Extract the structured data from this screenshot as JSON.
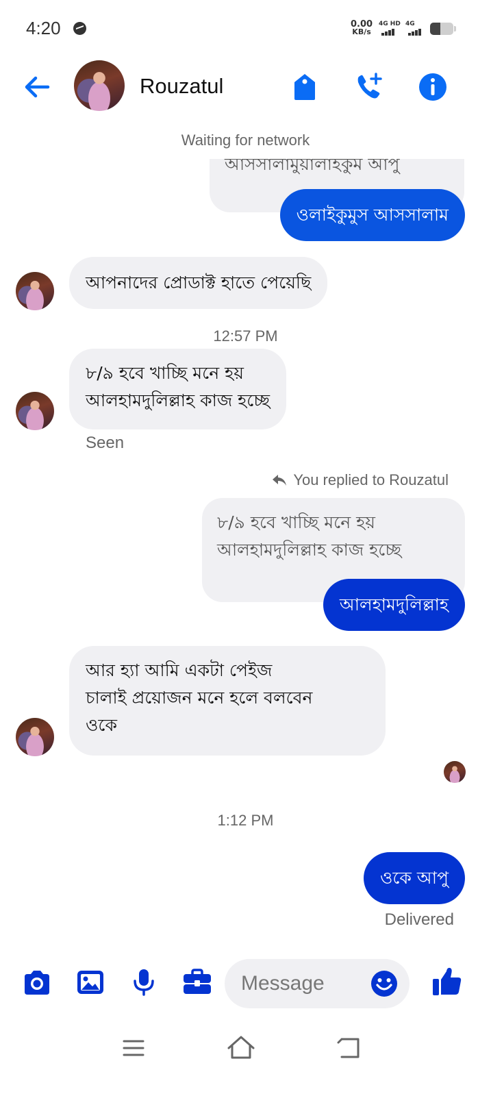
{
  "status_bar": {
    "time": "4:20",
    "net_speed_value": "0.00",
    "net_speed_unit": "KB/s",
    "sim1_label": "4G HD",
    "sim2_label": "4G"
  },
  "header": {
    "contact_name": "Rouzatul",
    "icons": [
      "back-arrow-icon",
      "tag-icon",
      "add-call-icon",
      "info-icon"
    ],
    "accent_color": "#0a6cf5"
  },
  "conversation": {
    "network_status": "Waiting for network",
    "messages": [
      {
        "direction": "out-quote",
        "text": "আসসালামুয়ালাইকুম আপু"
      },
      {
        "direction": "out",
        "text": "ওলাইকুমুস আসসালাম"
      },
      {
        "direction": "in",
        "text": "আপনাদের প্রোডাক্ট হাতে পেয়েছি"
      },
      {
        "direction": "timestamp",
        "text": "12:57 PM"
      },
      {
        "direction": "in",
        "lines": [
          "৮/৯ হবে খাচ্ছি মনে হয়",
          "আলহামদুলিল্লাহ কাজ হচ্ছে"
        ]
      },
      {
        "direction": "status",
        "text": "Seen"
      },
      {
        "direction": "reply-note",
        "text": "You replied to Rouzatul"
      },
      {
        "direction": "out-quote",
        "lines": [
          "৮/৯ হবে খাচ্ছি মনে হয়",
          "আলহামদুলিল্লাহ কাজ হচ্ছে"
        ]
      },
      {
        "direction": "out",
        "text": "আলহামদুলিল্লাহ"
      },
      {
        "direction": "in",
        "lines": [
          "আর হ্যা আমি একটা পেইজ",
          "চালাই প্রয়োজন মনে হলে বলবেন",
          "ওকে"
        ]
      },
      {
        "direction": "timestamp",
        "text": "1:12 PM"
      },
      {
        "direction": "out",
        "text": "ওকে আপু"
      },
      {
        "direction": "status",
        "text": "Delivered"
      }
    ],
    "bubble_colors": {
      "outgoing": "#0a55e0",
      "outgoing_latest": "#0434d1",
      "incoming": "#f0f0f3"
    }
  },
  "composer": {
    "placeholder": "Message",
    "icons": [
      "camera-icon",
      "gallery-icon",
      "microphone-icon",
      "toolbox-icon",
      "emoji-icon",
      "thumbs-up-icon"
    ],
    "icon_color": "#0434d1"
  },
  "nav_bar": {
    "icons": [
      "menu-icon",
      "home-icon",
      "back-icon"
    ]
  }
}
